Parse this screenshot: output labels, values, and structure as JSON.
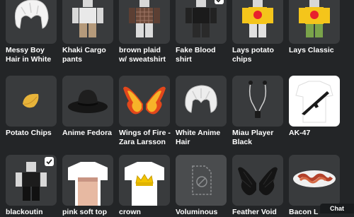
{
  "items": [
    {
      "name": "Messy Boy Hair in White",
      "line1": "Messy Boy",
      "line2": "Hair in White",
      "icon": "white-hair-icon",
      "checked": false
    },
    {
      "name": "Khaki Cargo pants",
      "line1": "Khaki Cargo",
      "line2": "pants",
      "icon": "khaki-pants-avatar-icon",
      "checked": false
    },
    {
      "name": "brown plaid w/ sweatshirt",
      "line1": "brown plaid",
      "line2": "w/ sweatshirt",
      "icon": "plaid-shirt-avatar-icon",
      "checked": false
    },
    {
      "name": "Fake Blood shirt",
      "line1": "Fake Blood",
      "line2": "shirt",
      "icon": "black-shirt-avatar-icon",
      "checked": true
    },
    {
      "name": "Lays potato chips",
      "line1": "Lays potato",
      "line2": "chips",
      "icon": "chips-bag-avatar-icon",
      "checked": false
    },
    {
      "name": "Lays Classic",
      "line1": "Lays Classic",
      "line2": "",
      "icon": "chips-bag-avatar-icon",
      "checked": false
    },
    {
      "name": "Potato Chips",
      "line1": "Potato Chips",
      "line2": "",
      "icon": "potato-chip-icon",
      "checked": false
    },
    {
      "name": "Anime Fedora",
      "line1": "Anime Fedora",
      "line2": "",
      "icon": "fedora-hat-icon",
      "checked": false
    },
    {
      "name": "Wings of Fire - Zara Larsson",
      "line1": "Wings of Fire -",
      "line2": "Zara Larsson",
      "icon": "fire-wings-icon",
      "checked": false
    },
    {
      "name": "White Anime Hair",
      "line1": "White Anime",
      "line2": "Hair",
      "icon": "white-hair-icon",
      "checked": false
    },
    {
      "name": "Miau Player Black",
      "line1": "Miau Player",
      "line2": "Black",
      "icon": "earphones-icon",
      "checked": false
    },
    {
      "name": "AK-47",
      "line1": "AK-47",
      "line2": "",
      "icon": "rifle-shirt-icon",
      "checked": false
    },
    {
      "name": "blackoutin",
      "line1": "blackoutin",
      "line2": "",
      "icon": "black-outfit-avatar-icon",
      "checked": true
    },
    {
      "name": "pink soft top",
      "line1": "pink soft top",
      "line2": "",
      "icon": "pink-shirt-icon",
      "checked": false
    },
    {
      "name": "crown",
      "line1": "crown",
      "line2": "",
      "icon": "crown-shirt-icon",
      "checked": false
    },
    {
      "name": "Voluminous",
      "line1": "Voluminous",
      "line2": "",
      "icon": "unavailable-file-icon",
      "checked": false
    },
    {
      "name": "Feather Void",
      "line1": "Feather Void",
      "line2": "",
      "icon": "black-wings-icon",
      "checked": false
    },
    {
      "name": "Bacon",
      "line1": "Bacon L",
      "line2": "",
      "icon": "bacon-plate-icon",
      "checked": false
    }
  ],
  "chat": {
    "label": "Chat"
  },
  "colors": {
    "background": "#232527",
    "tile": "#393b3d",
    "text": "#ffffff"
  }
}
